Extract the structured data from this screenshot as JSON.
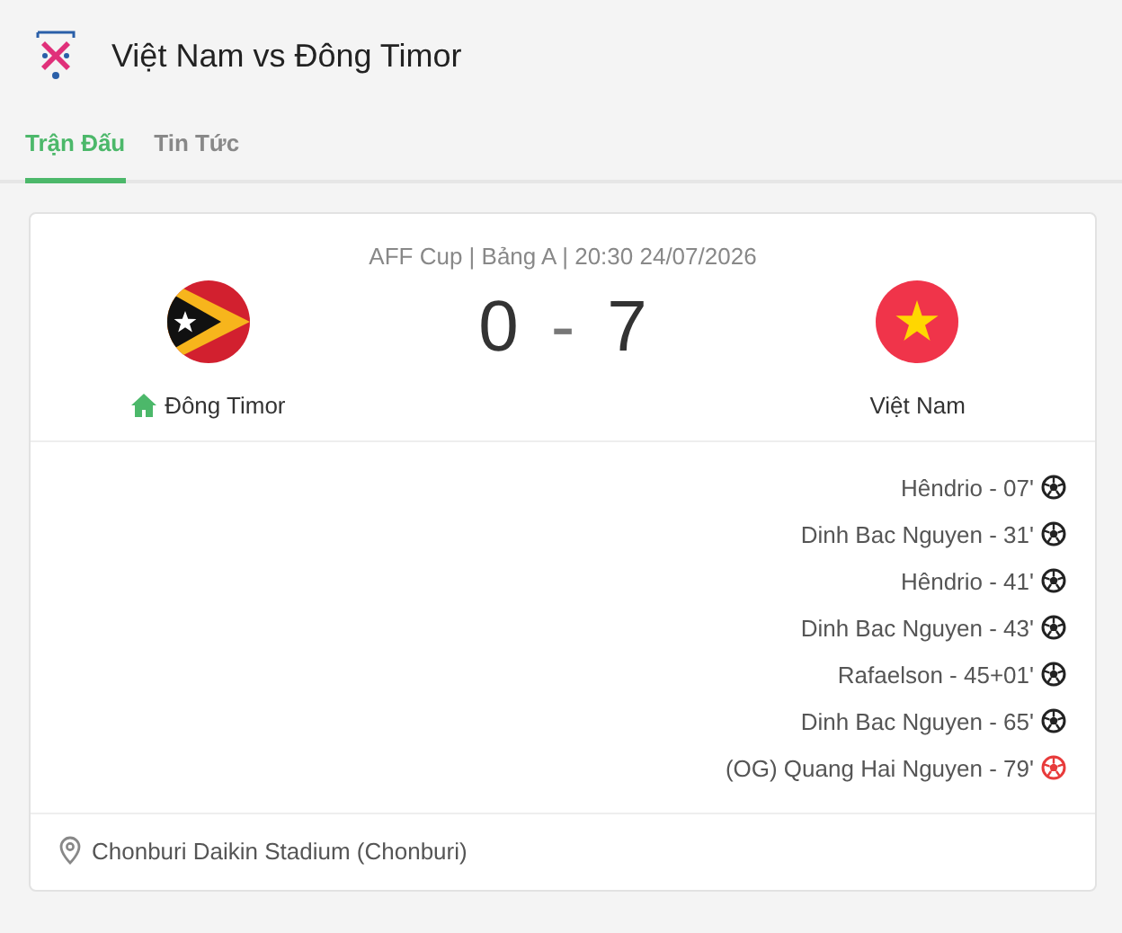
{
  "header": {
    "title": "Việt Nam vs Đông Timor"
  },
  "tabs": [
    {
      "label": "Trận Đấu",
      "selected": true
    },
    {
      "label": "Tin Tức",
      "selected": false
    }
  ],
  "match": {
    "info": "AFF Cup | Bảng A | 20:30 24/07/2026",
    "score_home": "0",
    "separator": "-",
    "score_away": "7",
    "home": {
      "name": "Đông Timor",
      "home": true
    },
    "away": {
      "name": "Việt Nam",
      "home": false
    }
  },
  "events": [
    {
      "text": "Hêndrio - 07'",
      "kind": "goal"
    },
    {
      "text": "Dinh Bac Nguyen - 31'",
      "kind": "goal"
    },
    {
      "text": "Hêndrio - 41'",
      "kind": "goal"
    },
    {
      "text": "Dinh Bac Nguyen - 43'",
      "kind": "goal"
    },
    {
      "text": "Rafaelson - 45+01'",
      "kind": "goal"
    },
    {
      "text": "Dinh Bac Nguyen - 65'",
      "kind": "goal"
    },
    {
      "text": "(OG) Quang Hai Nguyen - 79'",
      "kind": "own_goal"
    }
  ],
  "venue": "Chonburi Daikin Stadium (Chonburi)"
}
